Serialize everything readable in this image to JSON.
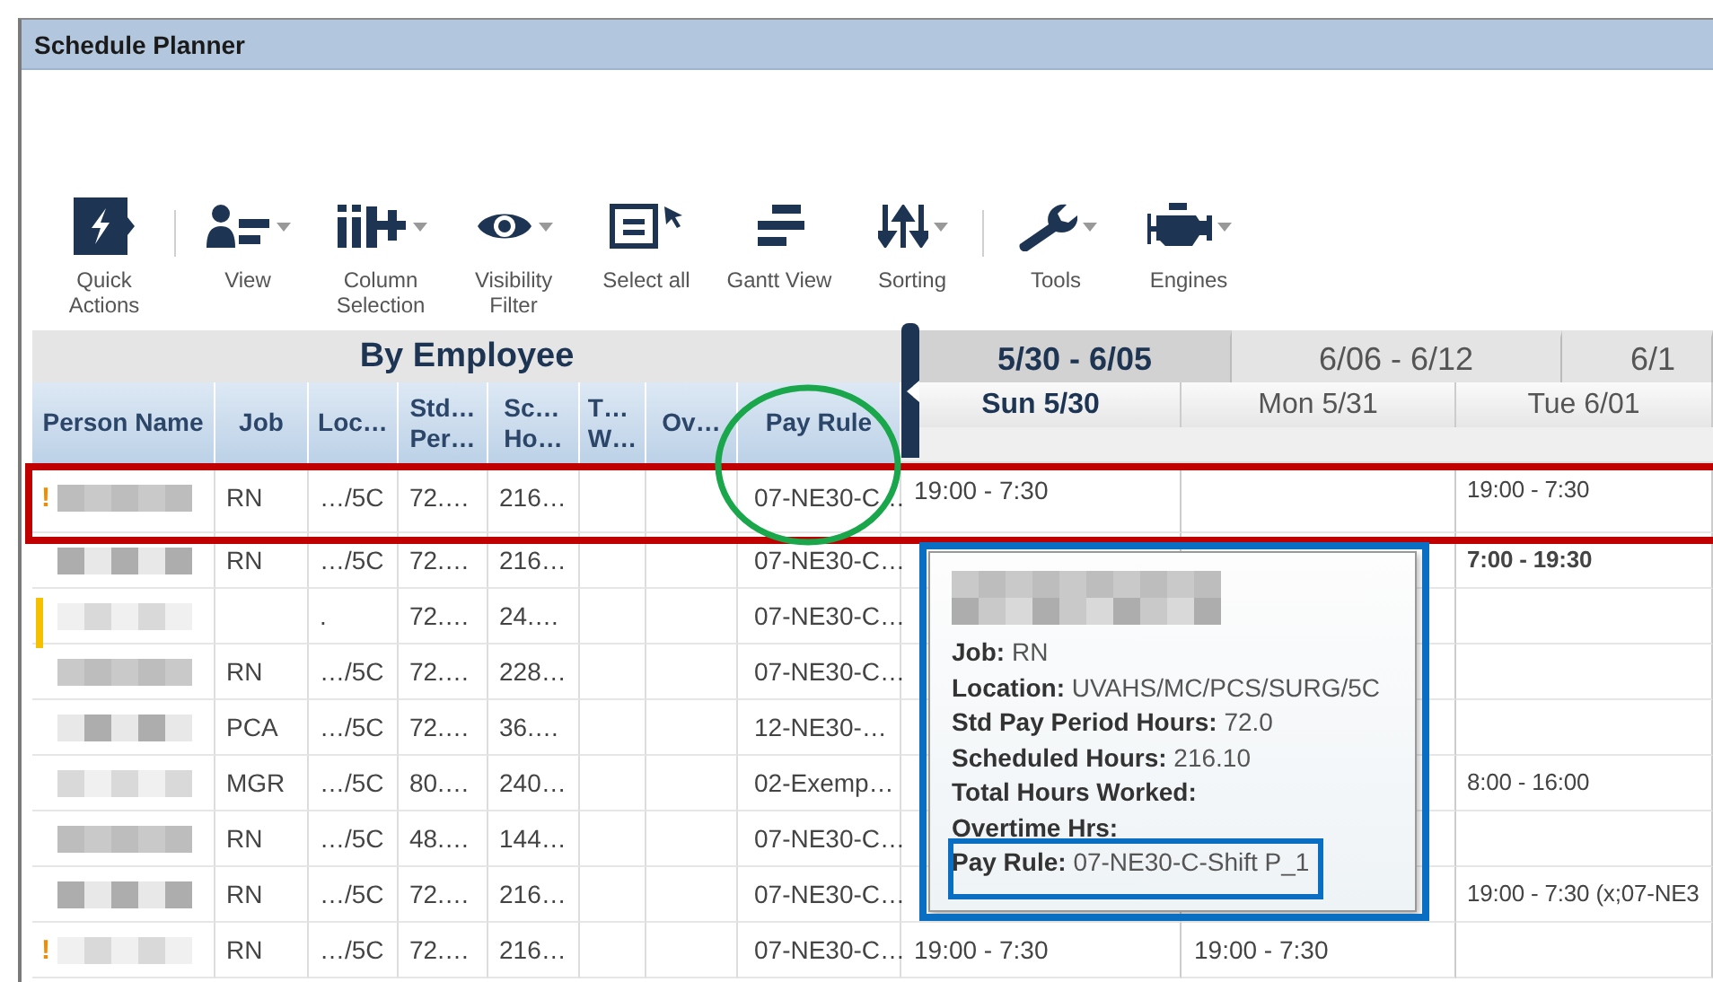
{
  "window": {
    "title": "Schedule Planner"
  },
  "toolbar": [
    {
      "label": "Quick Actions",
      "kind": "bolt",
      "dropdown": false,
      "separator_after": true
    },
    {
      "label": "View",
      "kind": "person-list",
      "dropdown": true,
      "separator_after": false
    },
    {
      "label": "Column Selection",
      "kind": "columns-add",
      "dropdown": true,
      "separator_after": false
    },
    {
      "label": "Visibility Filter",
      "kind": "eye",
      "dropdown": true,
      "separator_after": false
    },
    {
      "label": "Select all",
      "kind": "select-all",
      "dropdown": false,
      "separator_after": false
    },
    {
      "label": "Gantt View",
      "kind": "gantt",
      "dropdown": false,
      "separator_after": false
    },
    {
      "label": "Sorting",
      "kind": "sort",
      "dropdown": true,
      "separator_after": true
    },
    {
      "label": "Tools",
      "kind": "wrench",
      "dropdown": true,
      "separator_after": false
    },
    {
      "label": "Engines",
      "kind": "engine",
      "dropdown": true,
      "separator_after": false
    }
  ],
  "grid": {
    "title": "By Employee",
    "columns": [
      "Person Name",
      "Job",
      "Loc…",
      "Std…\nPer…",
      "Sc…\nHo…",
      "T…\nW…",
      "Ov…",
      "Pay Rule"
    ],
    "rows": [
      {
        "alert": "!",
        "marker": false,
        "job": "RN",
        "location": "…/5C",
        "std_hours": "72.…",
        "sched_hours": "216…",
        "pay_rule": "07-NE30-C…",
        "shifts": {
          "sun": {
            "text": "19:00 - 7:30",
            "bold": false
          },
          "tue": {
            "text": "19:00 - 7:30",
            "bold": false
          }
        }
      },
      {
        "marker": false,
        "job": "RN",
        "location": "…/5C",
        "std_hours": "72.…",
        "sched_hours": "216…",
        "pay_rule": "07-NE30-C…",
        "shifts": {
          "tue": {
            "text": "7:00 - 19:30",
            "bold": true
          }
        }
      },
      {
        "marker": true,
        "location": ".",
        "std_hours": "72.…",
        "sched_hours": "24.…",
        "pay_rule": "07-NE30-C…",
        "shifts": {}
      },
      {
        "marker": false,
        "job": "RN",
        "location": "…/5C",
        "std_hours": "72.…",
        "sched_hours": "228…",
        "pay_rule": "07-NE30-C…",
        "shifts": {}
      },
      {
        "marker": false,
        "job": "PCA",
        "location": "…/5C",
        "std_hours": "72.…",
        "sched_hours": "36.…",
        "pay_rule": "12-NE30-…",
        "shifts": {}
      },
      {
        "marker": false,
        "job": "MGR",
        "location": "…/5C",
        "std_hours": "80.…",
        "sched_hours": "240…",
        "pay_rule": "02-Exemp…",
        "shifts": {
          "tue": {
            "text": "8:00 - 16:00",
            "bold": false
          }
        }
      },
      {
        "marker": false,
        "job": "RN",
        "location": "…/5C",
        "std_hours": "48.…",
        "sched_hours": "144…",
        "pay_rule": "07-NE30-C…",
        "shifts": {}
      },
      {
        "marker": false,
        "job": "RN",
        "location": "…/5C",
        "std_hours": "72.…",
        "sched_hours": "216…",
        "pay_rule": "07-NE30-C…",
        "shifts": {
          "tue": {
            "text": "19:00 - 7:30 (x;07-NE3",
            "bold": false
          }
        }
      },
      {
        "alert": "!",
        "marker": false,
        "job": "RN",
        "location": "…/5C",
        "std_hours": "72.…",
        "sched_hours": "216…",
        "pay_rule": "07-NE30-C…",
        "shifts": {
          "sun": {
            "text": "19:00 - 7:30",
            "bold": false
          },
          "mon": {
            "text": "19:00 - 7:30",
            "bold": false
          }
        }
      }
    ]
  },
  "gantt": {
    "weeks": [
      {
        "label": "5/30 - 6/05",
        "selected": true
      },
      {
        "label": "6/06 - 6/12",
        "selected": false
      },
      {
        "label": "6/1",
        "selected": false
      }
    ],
    "days": [
      {
        "label": "Sun 5/30",
        "selected": true
      },
      {
        "label": "Mon 5/31",
        "selected": false
      },
      {
        "label": "Tue 6/01",
        "selected": false
      }
    ]
  },
  "tooltip": {
    "lines": [
      "**Job:** RN",
      "**Location:** UVAHS/MC/PCS/SURG/5C",
      "**Std Pay Period Hours:** 72.0",
      "**Scheduled Hours:** 216.10",
      "**Total Hours Worked:**",
      "**Overtime Hrs:**",
      "**Pay Rule:** 07-NE30-C-Shift P_1"
    ]
  },
  "annotations": [
    {
      "kind": "rectangle",
      "color": "#c00000"
    },
    {
      "kind": "ellipse",
      "color": "#1aa64a"
    },
    {
      "kind": "rectangle",
      "color": "#0a6fc2"
    },
    {
      "kind": "rectangle",
      "color": "#0a6fc2"
    }
  ]
}
